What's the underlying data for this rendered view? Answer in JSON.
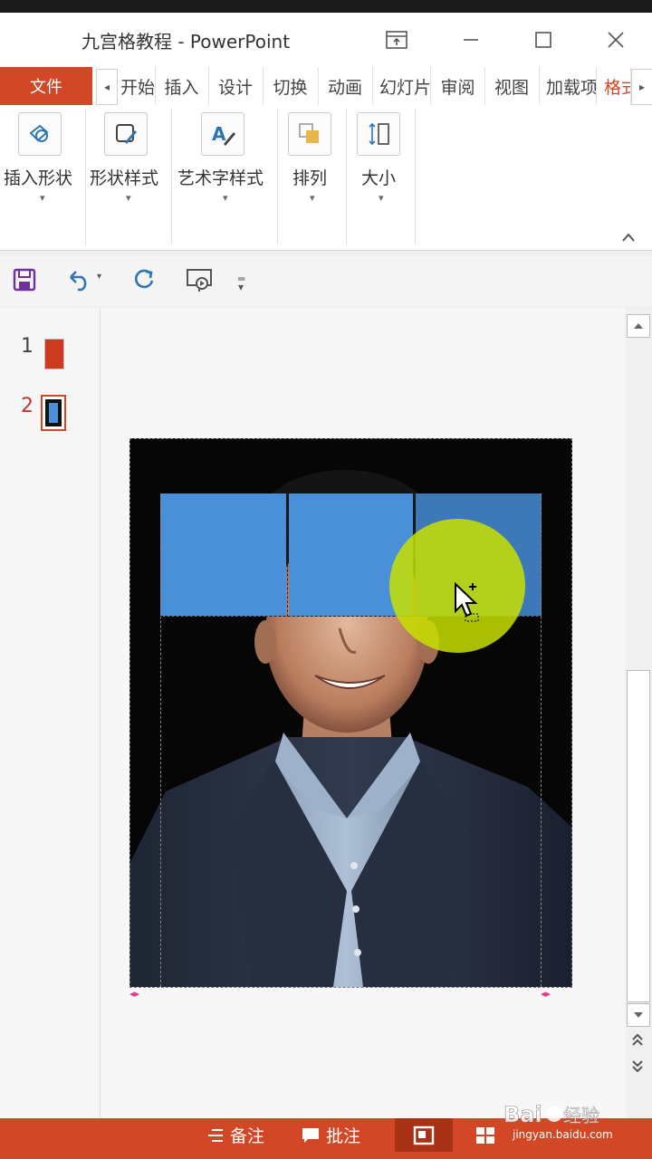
{
  "window": {
    "title": "九宫格教程 - PowerPoint",
    "buttons": [
      "restore-ribbon",
      "minimize",
      "maximize",
      "close"
    ]
  },
  "ribbon_tabs": {
    "file": "文件",
    "items": [
      "开始",
      "插入",
      "设计",
      "切换",
      "动画",
      "幻灯片放映",
      "审阅",
      "视图",
      "加载项",
      "格式"
    ],
    "active": "格式"
  },
  "ribbon_groups": [
    {
      "label": "插入形状",
      "icon": "insert-shape-icon"
    },
    {
      "label": "形状样式",
      "icon": "shape-style-icon"
    },
    {
      "label": "艺术字样式",
      "icon": "wordart-style-icon"
    },
    {
      "label": "排列",
      "icon": "arrange-icon"
    },
    {
      "label": "大小",
      "icon": "size-icon"
    }
  ],
  "quick_access": [
    "save-icon",
    "undo-icon",
    "redo-icon",
    "present-icon",
    "customize-icon"
  ],
  "slides": [
    {
      "number": "1",
      "selected": false
    },
    {
      "number": "2",
      "selected": true
    }
  ],
  "statusbar": {
    "notes": "备注",
    "comments": "批注"
  },
  "colors": {
    "accent": "#d24726",
    "tile_blue": "#4a90d9",
    "highlight": "#c8e000"
  },
  "watermark": {
    "brand": "Baidu经验",
    "url": "jingyan.baidu.com"
  }
}
